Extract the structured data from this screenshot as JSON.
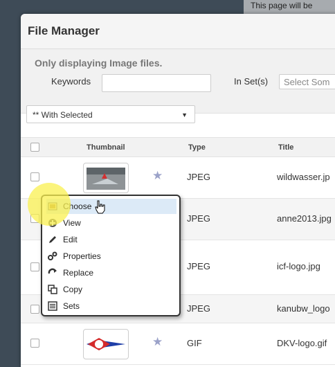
{
  "notice": "This page will be",
  "window": {
    "title": "File Manager"
  },
  "filter": {
    "note": "Only displaying Image files.",
    "keywords_label": "Keywords",
    "keywords_value": "",
    "set_label": "In Set(s)",
    "set_placeholder": "Select Som"
  },
  "bulk_action": {
    "selected": "** With Selected"
  },
  "table": {
    "headers": {
      "thumbnail": "Thumbnail",
      "type": "Type",
      "title": "Title"
    },
    "rows": [
      {
        "type": "JPEG",
        "title": "wildwasser.jp"
      },
      {
        "type": "JPEG",
        "title": "anne2013.jpg"
      },
      {
        "type": "JPEG",
        "title": "icf-logo.jpg"
      },
      {
        "type": "JPEG",
        "title": "kanubw_logo"
      },
      {
        "type": "GIF",
        "title": "DKV-logo.gif"
      }
    ]
  },
  "context_menu": {
    "items": [
      {
        "label": "Choose",
        "icon": "choose-icon"
      },
      {
        "label": "View",
        "icon": "view-icon"
      },
      {
        "label": "Edit",
        "icon": "pencil-icon"
      },
      {
        "label": "Properties",
        "icon": "gears-icon"
      },
      {
        "label": "Replace",
        "icon": "replace-icon"
      },
      {
        "label": "Copy",
        "icon": "copy-icon"
      },
      {
        "label": "Sets",
        "icon": "list-icon"
      }
    ]
  }
}
